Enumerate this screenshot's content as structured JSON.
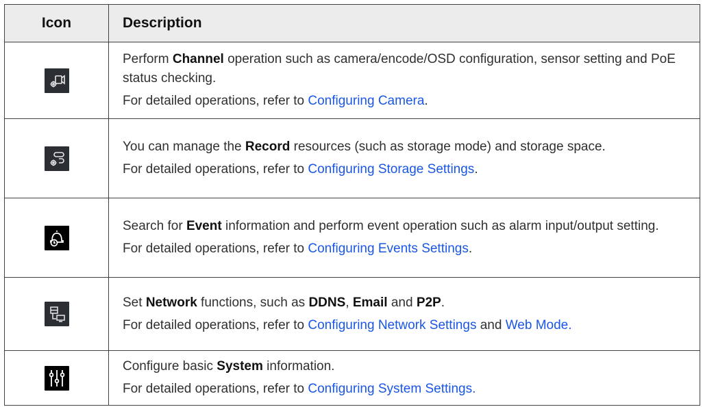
{
  "header": {
    "icon_col": "Icon",
    "desc_col": "Description"
  },
  "rows": [
    {
      "icon": "channel-camera-settings-icon",
      "p1_a": "Perform ",
      "p1_bold": "Channel",
      "p1_b": " operation such as camera/encode/OSD configuration, sensor setting and PoE status checking.",
      "p2_prefix": "For detailed operations, refer to ",
      "p2_link": "Configuring Camera",
      "p2_suffix": "."
    },
    {
      "icon": "record-storage-settings-icon",
      "p1_a": "You can manage the ",
      "p1_bold": "Record",
      "p1_b": " resources (such as storage mode) and storage space.",
      "p2_prefix": "For detailed operations, refer to ",
      "p2_link": "Configuring Storage Settings",
      "p2_suffix": "."
    },
    {
      "icon": "event-alarm-bell-icon",
      "p1_a": "Search for ",
      "p1_bold": "Event",
      "p1_b": " information and perform event operation such as alarm input/output setting.",
      "p2_prefix": "For detailed operations, refer to ",
      "p2_link": "Configuring Events Settings",
      "p2_suffix": "."
    },
    {
      "icon": "network-icon",
      "p1_a": "Set ",
      "p1_bold": "Network",
      "p1_b": " functions, such as ",
      "p1_bold2": "DDNS",
      "p1_c": ", ",
      "p1_bold3": "Email",
      "p1_d": " and ",
      "p1_bold4": "P2P",
      "p1_e": ".",
      "p2_prefix": "For detailed operations, refer to ",
      "p2_link": "Configuring Network Settings",
      "p2_mid": " and ",
      "p2_link2": "Web Mode.",
      "p2_suffix": ""
    },
    {
      "icon": "system-sliders-icon",
      "p1_a": "Configure basic ",
      "p1_bold": "System",
      "p1_b": " information.",
      "p2_prefix": "For detailed operations, refer to ",
      "p2_link": "Configuring System Settings.",
      "p2_suffix": ""
    }
  ],
  "colors": {
    "link": "#1a56e6",
    "header_bg": "#ececec",
    "icon_bg": "#2b2f33"
  }
}
